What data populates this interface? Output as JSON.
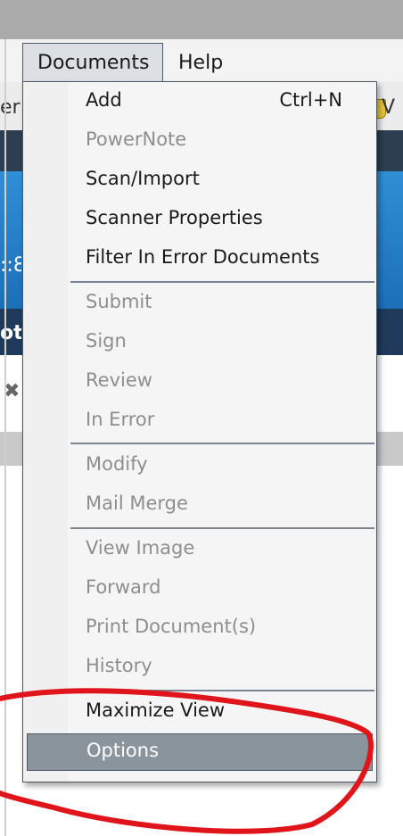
{
  "menubar": {
    "documents": "Documents",
    "help": "Help"
  },
  "background": {
    "toolbar_left_fragment": "er",
    "toolbar_right_fragment": "V",
    "band_left_fragment": "::8",
    "navy_left_fragment": "ot",
    "tool_icon": "✖"
  },
  "menu": {
    "add": "Add",
    "add_shortcut": "Ctrl+N",
    "powernote": "PowerNote",
    "scan_import": "Scan/Import",
    "scanner_properties": "Scanner Properties",
    "filter_in_error": "Filter In Error Documents",
    "submit": "Submit",
    "sign": "Sign",
    "review": "Review",
    "in_error": "In Error",
    "modify": "Modify",
    "mail_merge": "Mail Merge",
    "view_image": "View Image",
    "forward": "Forward",
    "print_documents": "Print Document(s)",
    "history": "History",
    "maximize_view": "Maximize View",
    "options": "Options"
  },
  "colors": {
    "selection": "#8a949d",
    "annotation": "#e0141b",
    "disabled_text": "#8e8e8e"
  }
}
